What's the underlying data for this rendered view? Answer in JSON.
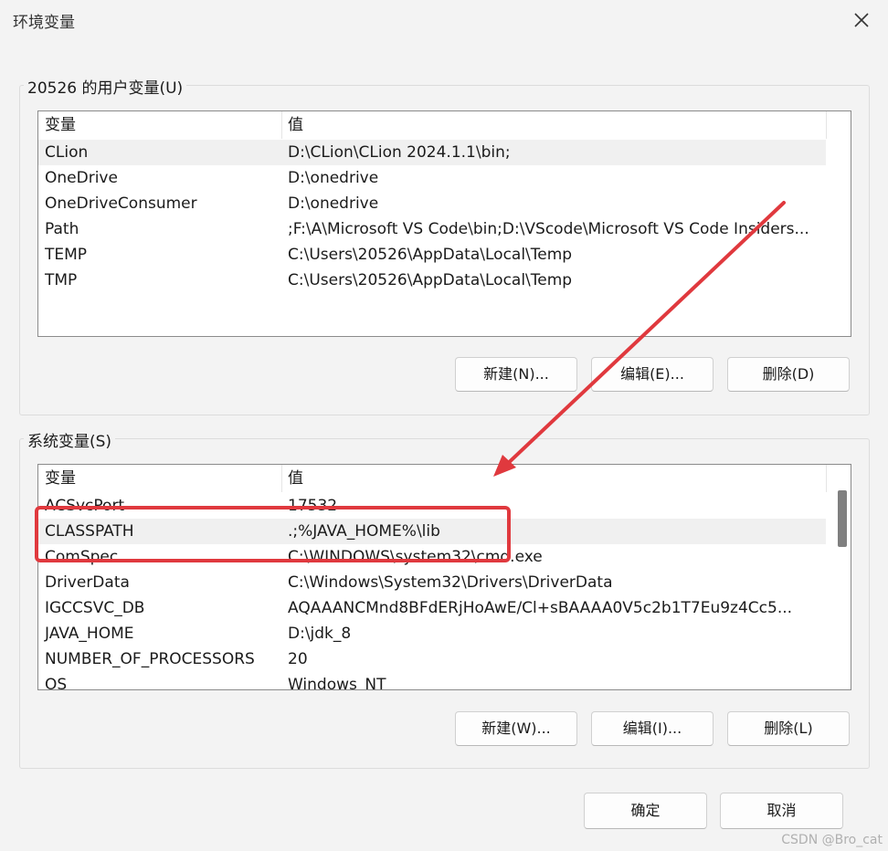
{
  "window": {
    "title": "环境变量",
    "close_icon": "close-icon"
  },
  "user_vars": {
    "group_label": "20526 的用户变量(U)",
    "headers": {
      "name": "变量",
      "value": "值"
    },
    "rows": [
      {
        "name": "CLion",
        "value": "D:\\CLion\\CLion 2024.1.1\\bin;"
      },
      {
        "name": "OneDrive",
        "value": "D:\\onedrive"
      },
      {
        "name": "OneDriveConsumer",
        "value": "D:\\onedrive"
      },
      {
        "name": "Path",
        "value": ";F:\\A\\Microsoft VS Code\\bin;D:\\VScode\\Microsoft VS Code Insiders..."
      },
      {
        "name": "TEMP",
        "value": "C:\\Users\\20526\\AppData\\Local\\Temp"
      },
      {
        "name": "TMP",
        "value": "C:\\Users\\20526\\AppData\\Local\\Temp"
      }
    ],
    "buttons": {
      "new": "新建(N)...",
      "edit": "编辑(E)...",
      "delete": "删除(D)"
    }
  },
  "system_vars": {
    "group_label": "系统变量(S)",
    "headers": {
      "name": "变量",
      "value": "值"
    },
    "rows": [
      {
        "name": "ACSvcPort",
        "value": "17532"
      },
      {
        "name": "CLASSPATH",
        "value": ".;%JAVA_HOME%\\lib"
      },
      {
        "name": "ComSpec",
        "value": "C:\\WINDOWS\\system32\\cmd.exe"
      },
      {
        "name": "DriverData",
        "value": "C:\\Windows\\System32\\Drivers\\DriverData"
      },
      {
        "name": "IGCCSVC_DB",
        "value": "AQAAANCMnd8BFdERjHoAwE/Cl+sBAAAA0V5c2b1T7Eu9z4Cc5..."
      },
      {
        "name": "JAVA_HOME",
        "value": "D:\\jdk_8"
      },
      {
        "name": "NUMBER_OF_PROCESSORS",
        "value": "20"
      },
      {
        "name": "OS",
        "value": "Windows_NT"
      }
    ],
    "buttons": {
      "new": "新建(W)...",
      "edit": "编辑(I)...",
      "delete": "删除(L)"
    }
  },
  "footer": {
    "ok": "确定",
    "cancel": "取消"
  },
  "annotation": {
    "color": "#e0393e"
  },
  "watermark": "CSDN @Bro_cat"
}
